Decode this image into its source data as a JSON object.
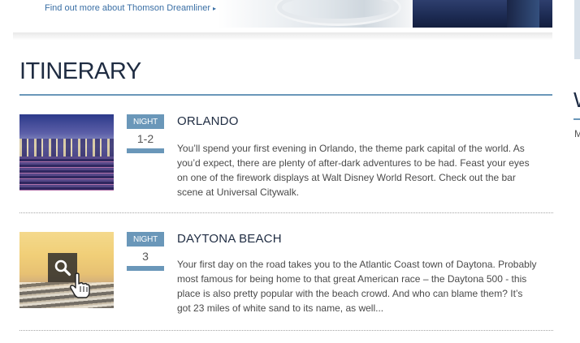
{
  "banner": {
    "link_label": "Find out more about Thomson Dreamliner",
    "link_arrow": "▸"
  },
  "sidebar": {
    "heading_fragment": "W",
    "text_fragment": "M"
  },
  "itinerary": {
    "title": "ITINERARY",
    "night_label": "NIGHT",
    "stops": [
      {
        "nights": "1-2",
        "place": "ORLANDO",
        "description": "You’ll spend your first evening in Orlando, the theme park capital of the world. As you’d expect, there are plenty of after-dark adventures to be had. Feast your eyes on one of the firework displays at Walt Disney World Resort. Check out the bar scene at Universal Citywalk."
      },
      {
        "nights": "3",
        "place": "DAYTONA BEACH",
        "description": "Your first day on the road takes you to the Atlantic Coast town of Daytona. Probably most famous for being home to that great American race – the Daytona 500 - this place is also pretty popular with the beach crowd. And who can blame them? It’s got 23 miles of white sand to its name, as well..."
      }
    ]
  },
  "colors": {
    "accent": "#6a97b9",
    "heading": "#1f2c42",
    "link": "#3a6fa5"
  },
  "icons": [
    "chevron-right-icon",
    "magnifier-icon",
    "hand-cursor-icon"
  ]
}
